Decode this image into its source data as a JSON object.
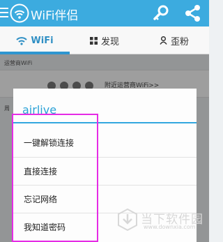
{
  "header": {
    "title": "WiFi伴侣",
    "menu_icon": "menu-icon",
    "logo_icon": "wifi-logo-icon",
    "actions": [
      "key-icon",
      "share-icon"
    ],
    "accent_color": "#3cabdf"
  },
  "tabs": [
    {
      "label": "WiFi",
      "icon": "wifi-icon",
      "active": true
    },
    {
      "label": "发现",
      "icon": "grid-icon",
      "active": false
    },
    {
      "label": "歪粉",
      "icon": "person-icon",
      "active": false
    }
  ],
  "background": {
    "operator_label": "运营商WiFi",
    "operator_link": "附近运营商WiFi>>",
    "surround_label": "周"
  },
  "dialog": {
    "title": "airlive",
    "options": [
      "一键解锁连接",
      "直接连接",
      "忘记网络",
      "我知道密码"
    ],
    "highlight_color": "#e52be5"
  },
  "watermark": {
    "name": "当下软件园",
    "url": "www.downxia.com"
  }
}
